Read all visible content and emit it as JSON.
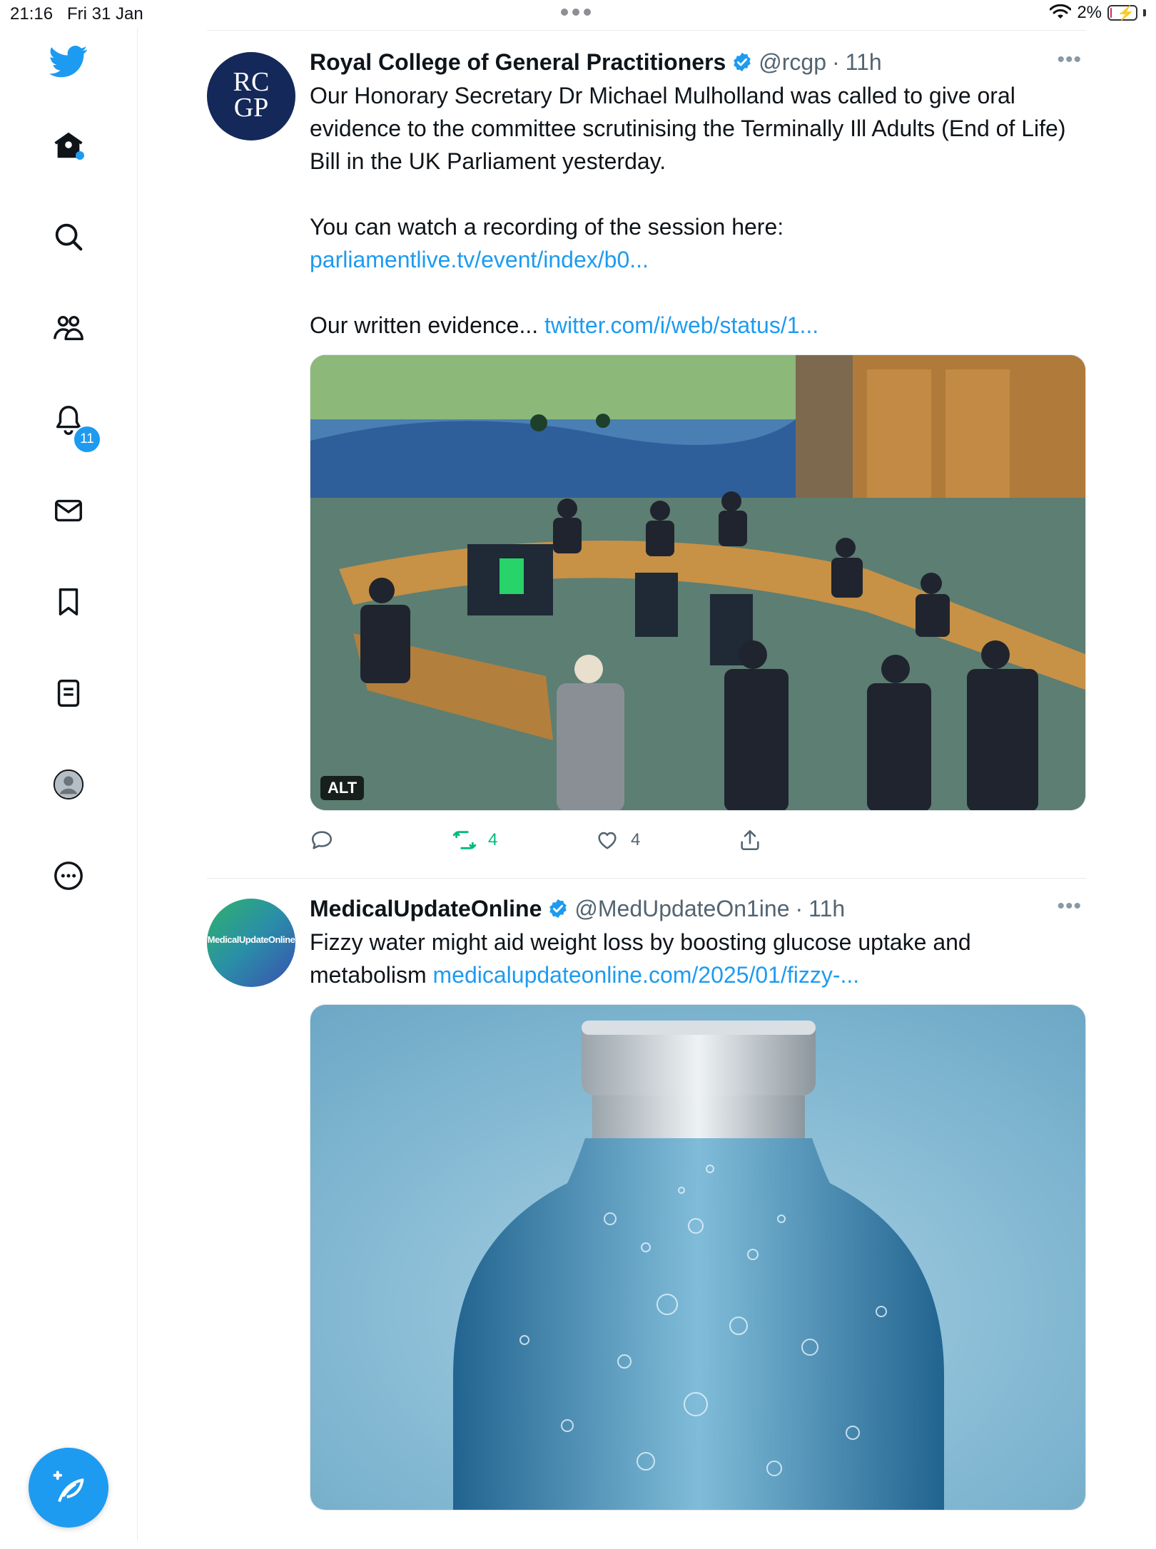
{
  "status_bar": {
    "time": "21:16",
    "date": "Fri 31 Jan",
    "battery_percent": "2%",
    "battery_level": 0.02
  },
  "sidebar": {
    "items": [
      {
        "name": "home",
        "icon": "home-icon"
      },
      {
        "name": "explore",
        "icon": "search-icon"
      },
      {
        "name": "communities",
        "icon": "communities-icon"
      },
      {
        "name": "notifications",
        "icon": "bell-icon",
        "badge": "11"
      },
      {
        "name": "messages",
        "icon": "envelope-icon"
      },
      {
        "name": "bookmarks",
        "icon": "bookmark-icon"
      },
      {
        "name": "lists",
        "icon": "list-icon"
      },
      {
        "name": "profile",
        "icon": "profile-avatar-icon"
      },
      {
        "name": "more",
        "icon": "more-circle-icon"
      }
    ],
    "compose_icon": "compose-feather-icon"
  },
  "tweets": [
    {
      "author": "Royal College of General Practitioners",
      "handle": "@rcgp",
      "time": "11h",
      "avatar_text_1": "RC",
      "avatar_text_2": "GP",
      "text_1": "Our Honorary Secretary Dr Michael Mulholland was called to give oral evidence to the committee scrutinising the Terminally Ill Adults (End of Life) Bill in the UK Parliament yesterday.\n\nYou can watch a recording of the session here: ",
      "link_1": "parliamentlive.tv/event/index/b0...",
      "text_2": "\n\nOur written evidence... ",
      "link_2": "twitter.com/i/web/status/1...",
      "media_alt_badge": "ALT",
      "retweets": "4",
      "likes": "4"
    },
    {
      "author": "MedicalUpdateOnline",
      "handle": "@MedUpdateOn1ine",
      "time": "11h",
      "avatar_text": "MedicalUpdateOnline",
      "text_1": "Fizzy water might aid weight loss by boosting glucose uptake and metabolism ",
      "link_1": "medicalupdateonline.com/2025/01/fizzy-..."
    }
  ],
  "colors": {
    "accent": "#1d9bf0",
    "retweet_green": "#00ba7c",
    "rcgp_navy": "#14295a"
  }
}
